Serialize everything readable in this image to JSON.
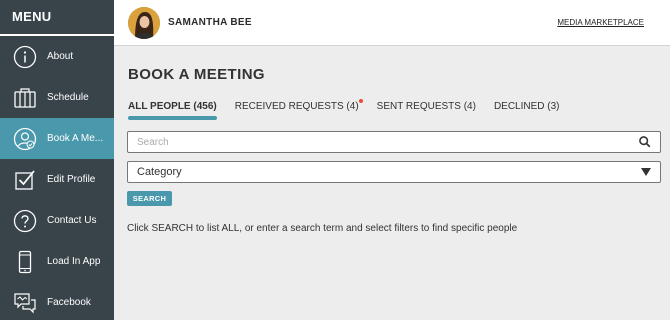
{
  "sidebar": {
    "title": "MENU",
    "items": [
      {
        "label": "About",
        "icon": "info-icon"
      },
      {
        "label": "Schedule",
        "icon": "calendar-book-icon"
      },
      {
        "label": "Book A Me...",
        "icon": "user-check-icon",
        "active": true
      },
      {
        "label": "Edit Profile",
        "icon": "edit-check-icon"
      },
      {
        "label": "Contact Us",
        "icon": "question-icon"
      },
      {
        "label": "Load In App",
        "icon": "mobile-phone-icon"
      },
      {
        "label": "Facebook",
        "icon": "facebook-chat-icon"
      }
    ]
  },
  "header": {
    "user_name": "SAMANTHA BEE",
    "marketplace_link": "MEDIA MARKETPLACE"
  },
  "main": {
    "title": "BOOK A MEETING",
    "tabs": [
      {
        "label": "ALL PEOPLE (456)",
        "active": true
      },
      {
        "label": "RECEIVED REQUESTS (4)",
        "notification": true
      },
      {
        "label": "SENT REQUESTS (4)"
      },
      {
        "label": "DECLINED (3)"
      }
    ],
    "search": {
      "placeholder": "Search",
      "value": ""
    },
    "category": {
      "selected": "Category"
    },
    "search_button": "SEARCH",
    "help_text": "Click SEARCH to list ALL, or enter a search term and select filters to find specific people"
  },
  "colors": {
    "sidebar_bg": "#38434a",
    "accent": "#4a98ab",
    "notification_dot": "#e74c3c"
  }
}
